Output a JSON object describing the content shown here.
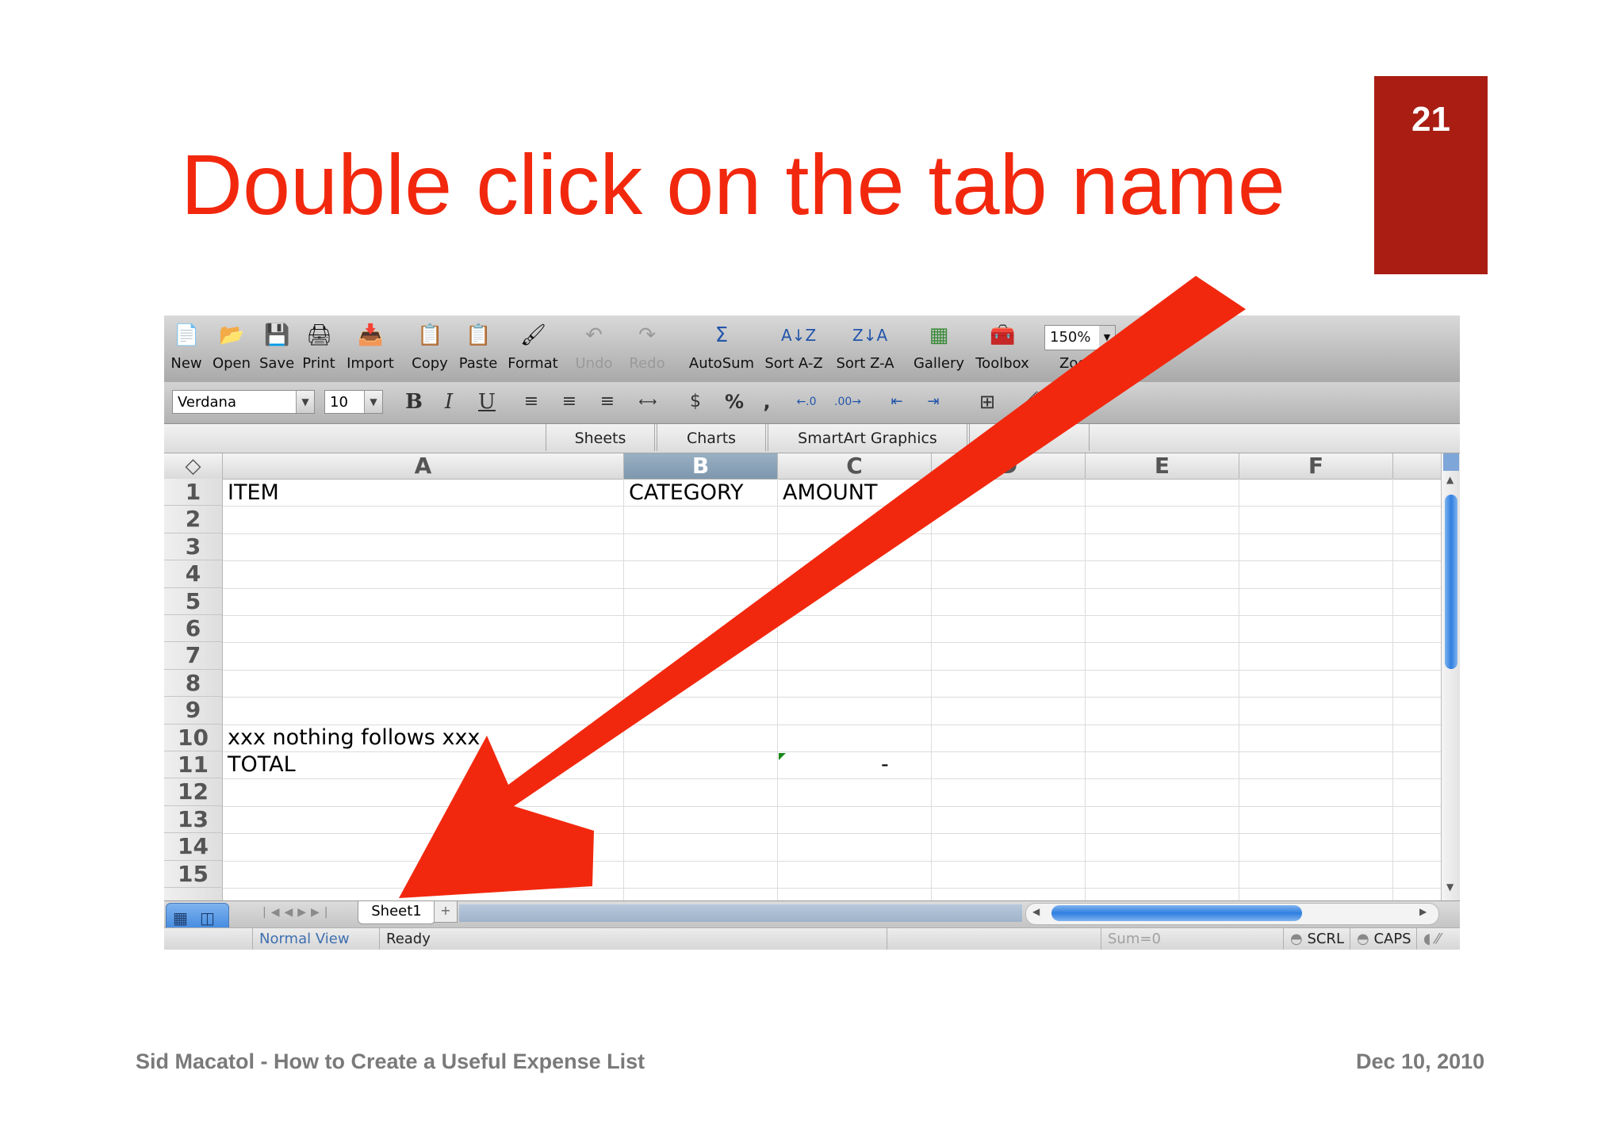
{
  "slide": {
    "title": "Double click on the tab name",
    "page_number": "21",
    "footer_left": "Sid Macatol - How to Create a Useful Expense List",
    "footer_right": "Dec 10, 2010",
    "accent_color": "#f2280e",
    "badge_color": "#a91d13",
    "arrow_icon": "red-arrow-icon"
  },
  "toolbar": {
    "new": "New",
    "open": "Open",
    "save": "Save",
    "print": "Print",
    "import": "Import",
    "copy": "Copy",
    "paste": "Paste",
    "format": "Format",
    "undo": "Undo",
    "redo": "Redo",
    "autosum": "AutoSum",
    "sort_az": "Sort A-Z",
    "sort_za": "Sort Z-A",
    "gallery": "Gallery",
    "toolbox": "Toolbox",
    "zoom_value": "150%",
    "zoom": "Zoom"
  },
  "format_bar": {
    "font": "Verdana",
    "size": "10",
    "bold": "B",
    "italic": "I",
    "underline": "U",
    "percent": "%",
    "comma": ","
  },
  "ribbon": {
    "tabs": [
      "Sheets",
      "Charts",
      "SmartArt Graphics"
    ]
  },
  "sheet": {
    "corner": "◇",
    "columns": [
      "A",
      "B",
      "C",
      "D",
      "E",
      "F"
    ],
    "rows": [
      "1",
      "2",
      "3",
      "4",
      "5",
      "6",
      "7",
      "8",
      "9",
      "10",
      "11",
      "12",
      "13",
      "14",
      "15"
    ],
    "cells": {
      "A1": "ITEM",
      "B1": "CATEGORY",
      "C1": "AMOUNT",
      "A10": "xxx nothing follows xxx",
      "A11": "TOTAL",
      "C11": "-"
    },
    "sheet_tab": "Sheet1",
    "add_tab": "+"
  },
  "status": {
    "view": "Normal View",
    "state": "Ready",
    "sum": "Sum=0",
    "scrl": "SCRL",
    "caps": "CAPS"
  }
}
